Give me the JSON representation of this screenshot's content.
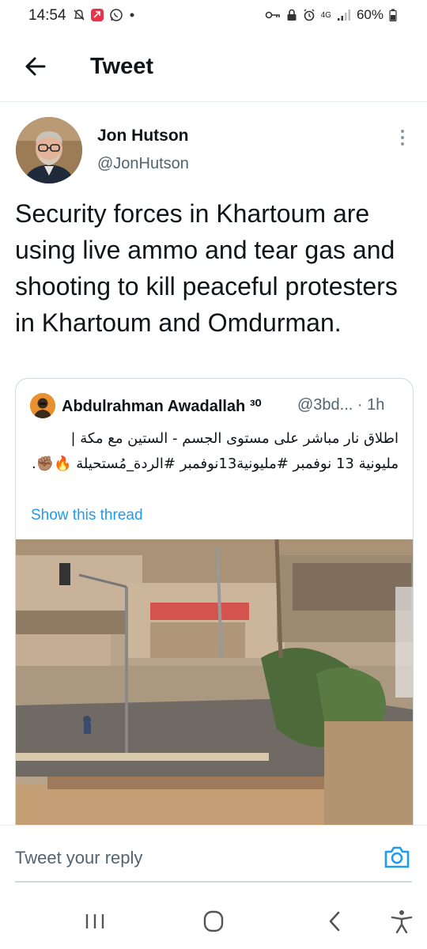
{
  "status_bar": {
    "time": "14:54",
    "network": "4G",
    "battery": "60%"
  },
  "header": {
    "title": "Tweet",
    "back_icon": "arrow-left-icon"
  },
  "tweet": {
    "author_name": "Jon Hutson",
    "author_handle": "@JonHutson",
    "text": "Security forces in Khartoum are using live ammo and tear gas and shooting to kill peaceful protesters in Khartoum and Omdurman."
  },
  "quote": {
    "author_name": "Abdulrahman Awadallah ³⁰",
    "author_handle": "@3bd... · 1h",
    "text": "اطلاق نار مباشر على مستوى الجسم - الستين مع مكة | مليونية 13 نوفمبر #مليونية13نوفمبر #الردة_مُستحيلة 🔥✊🏽.",
    "show_thread": "Show this thread"
  },
  "reply": {
    "placeholder": "Tweet your reply",
    "camera_icon": "camera-icon"
  },
  "colors": {
    "accent": "#1d9bf0",
    "text": "#0f1419",
    "secondary": "#536471",
    "border": "#cfd9de"
  }
}
